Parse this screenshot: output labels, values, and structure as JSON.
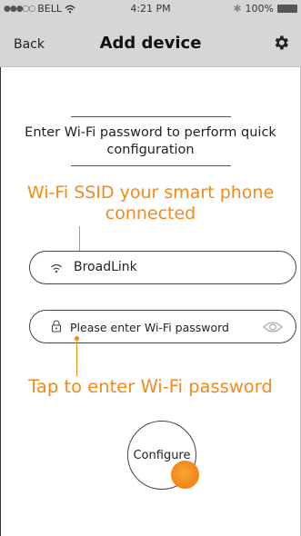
{
  "status_bar": {
    "signal": "●●●○○",
    "carrier": "BELL",
    "time": "4:21 PM",
    "battery": "100%",
    "icons": [
      "wifi-icon",
      "bluetooth-icon",
      "battery-icon"
    ]
  },
  "nav": {
    "back_label": "Back",
    "title": "Add device",
    "settings_icon": "gear-icon"
  },
  "hint": {
    "text": "Enter Wi-Fi password to perform quick configuration"
  },
  "annotations": {
    "ssid": "Wi-Fi SSID your smart phone connected",
    "password": "Tap to enter Wi-Fi password",
    "color": "#f28a1a"
  },
  "ssid_field": {
    "icon": "wifi-icon",
    "value": "BroadLink"
  },
  "password_field": {
    "icon": "lock-icon",
    "placeholder": "Please enter Wi-Fi password",
    "value": "",
    "toggle_icon": "eye-icon"
  },
  "configure": {
    "label": "Configure"
  },
  "colors": {
    "bar_bg": "#d6d6d6",
    "accent": "#f28a1a"
  }
}
